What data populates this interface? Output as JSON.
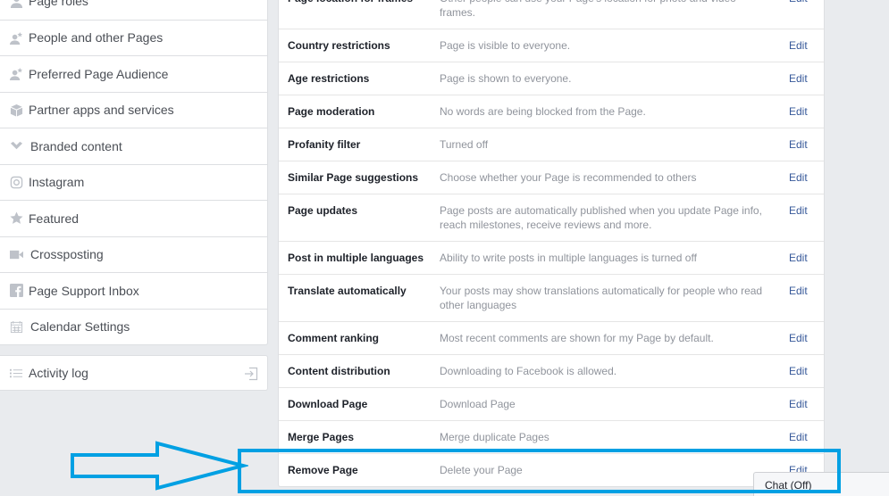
{
  "sidebar": {
    "items": [
      {
        "label": "Page roles",
        "icon": "person-icon"
      },
      {
        "label": "People and other Pages",
        "icon": "person-star-icon"
      },
      {
        "label": "Preferred Page Audience",
        "icon": "person-star-icon"
      },
      {
        "label": "Partner apps and services",
        "icon": "cube-icon"
      },
      {
        "label": "Branded content",
        "icon": "handshake-icon"
      },
      {
        "label": "Instagram",
        "icon": "instagram-icon"
      },
      {
        "label": "Featured",
        "icon": "star-icon"
      },
      {
        "label": "Crossposting",
        "icon": "video-camera-icon"
      },
      {
        "label": "Page Support Inbox",
        "icon": "facebook-icon"
      },
      {
        "label": "Calendar Settings",
        "icon": "calendar-icon"
      }
    ],
    "activity_log": {
      "label": "Activity log",
      "icon": "list-icon",
      "action_icon": "exit-icon"
    }
  },
  "settings": {
    "edit_label": "Edit",
    "rows": [
      {
        "title": "Page location for frames",
        "desc": "Other people can use your Page's location for photo and video frames."
      },
      {
        "title": "Country restrictions",
        "desc": "Page is visible to everyone."
      },
      {
        "title": "Age restrictions",
        "desc": "Page is shown to everyone."
      },
      {
        "title": "Page moderation",
        "desc": "No words are being blocked from the Page."
      },
      {
        "title": "Profanity filter",
        "desc": "Turned off"
      },
      {
        "title": "Similar Page suggestions",
        "desc": "Choose whether your Page is recommended to others"
      },
      {
        "title": "Page updates",
        "desc": "Page posts are automatically published when you update Page info, reach milestones, receive reviews and more."
      },
      {
        "title": "Post in multiple languages",
        "desc": "Ability to write posts in multiple languages is turned off"
      },
      {
        "title": "Translate automatically",
        "desc": "Your posts may show translations automatically for people who read other languages"
      },
      {
        "title": "Comment ranking",
        "desc": "Most recent comments are shown for my Page by default."
      },
      {
        "title": "Content distribution",
        "desc": "Downloading to Facebook is allowed."
      },
      {
        "title": "Download Page",
        "desc": "Download Page"
      },
      {
        "title": "Merge Pages",
        "desc": "Merge duplicate Pages"
      },
      {
        "title": "Remove Page",
        "desc": "Delete your Page"
      }
    ]
  },
  "chat": {
    "label": "Chat (Off)"
  },
  "annotation": {
    "color": "#00a0e3",
    "target": "Remove Page"
  }
}
